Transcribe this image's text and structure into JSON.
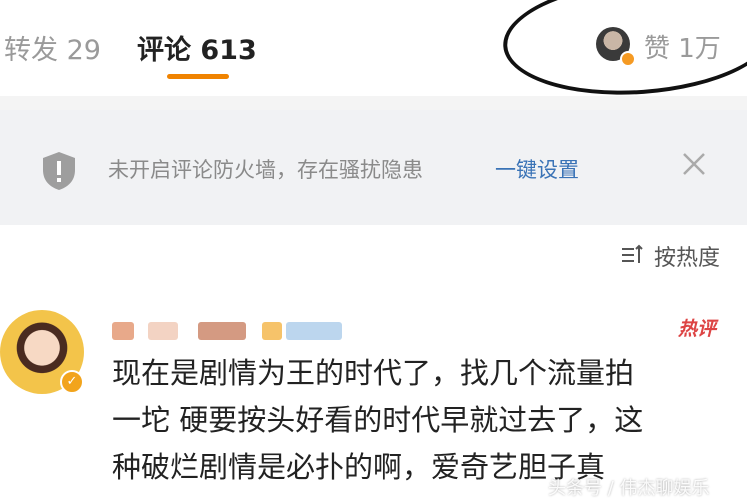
{
  "tabs": {
    "repost": "转发 29",
    "comment": "评论 613",
    "like": "赞 1万"
  },
  "firewall": {
    "message": "未开启评论防火墙，存在骚扰隐患",
    "link": "一键设置",
    "icons": [
      "shield-icon",
      "close-icon"
    ]
  },
  "sort": {
    "label": "按热度",
    "icon": "sort-icon"
  },
  "comment": {
    "hot_badge": "热评",
    "lines": [
      "现在是剧情为王的时代了，找几个流量拍",
      "一坨 硬要按头好看的时代早就过去了，这",
      "种破烂剧情是必扑的啊，爱奇艺胆子真"
    ]
  },
  "watermark": "头条号 / 伟杰聊娱乐",
  "colors": {
    "accent": "#f08300",
    "link": "#3a73b6",
    "hot": "#dd4444"
  }
}
